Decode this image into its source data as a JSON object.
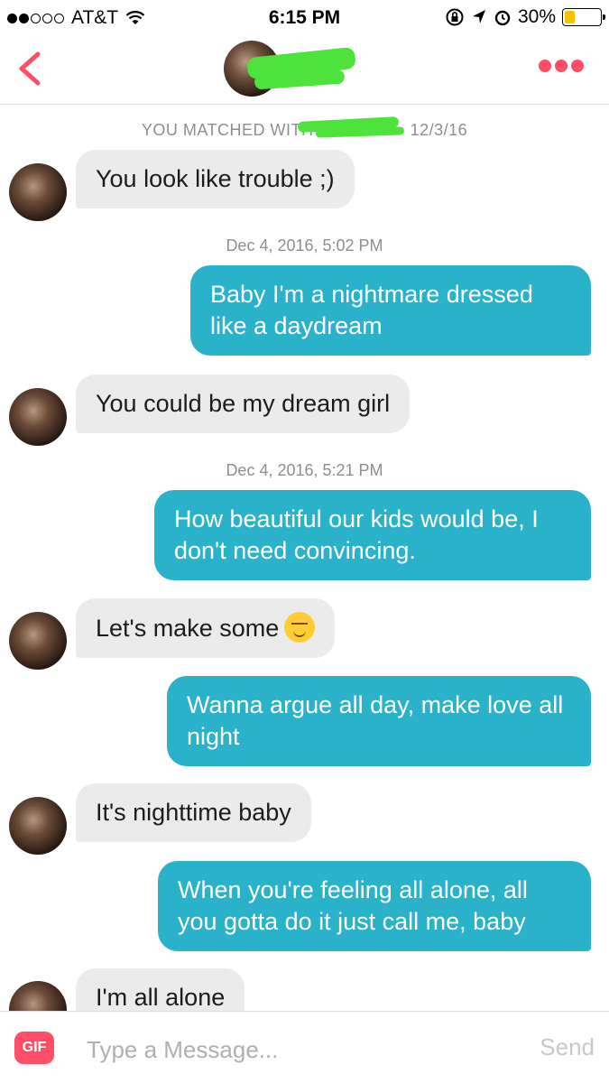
{
  "status_bar": {
    "carrier": "AT&T",
    "time": "6:15 PM",
    "battery": "30%",
    "battery_level": 0.3,
    "signal_bars_filled": 2,
    "icons": [
      "wifi-icon",
      "rotation-lock-icon",
      "location-icon",
      "alarm-icon",
      "battery-icon"
    ]
  },
  "nav": {
    "back_icon": "chevron-left-icon",
    "more_icon": "more-dots-icon",
    "accent_color": "#ff4f68"
  },
  "chat": {
    "match_text": "YOU MATCHED WITH",
    "match_date": "12/3/16",
    "timestamps": [
      "Dec 4, 2016, 5:02 PM",
      "Dec 4, 2016, 5:21 PM"
    ],
    "messages": [
      {
        "direction": "in",
        "text": "You look like trouble ;)"
      },
      {
        "direction": "out",
        "text": "Baby I'm a nightmare dressed like a daydream"
      },
      {
        "direction": "in",
        "text": "You could be my dream girl"
      },
      {
        "direction": "out",
        "text": "How beautiful our kids would be, I don't need convincing."
      },
      {
        "direction": "in",
        "text": "Let's make some",
        "emoji": "smirk-emoji"
      },
      {
        "direction": "out",
        "text": "Wanna argue all day, make love all night"
      },
      {
        "direction": "in",
        "text": "It's nighttime baby"
      },
      {
        "direction": "out",
        "text": "When you're feeling all alone, all you gotta do it just call me, baby"
      },
      {
        "direction": "in",
        "text": "I'm all alone"
      }
    ],
    "outgoing_color": "#2bb2cb",
    "incoming_color": "#ebebeb"
  },
  "input_bar": {
    "gif_label": "GIF",
    "placeholder": "Type a Message...",
    "send_label": "Send"
  }
}
